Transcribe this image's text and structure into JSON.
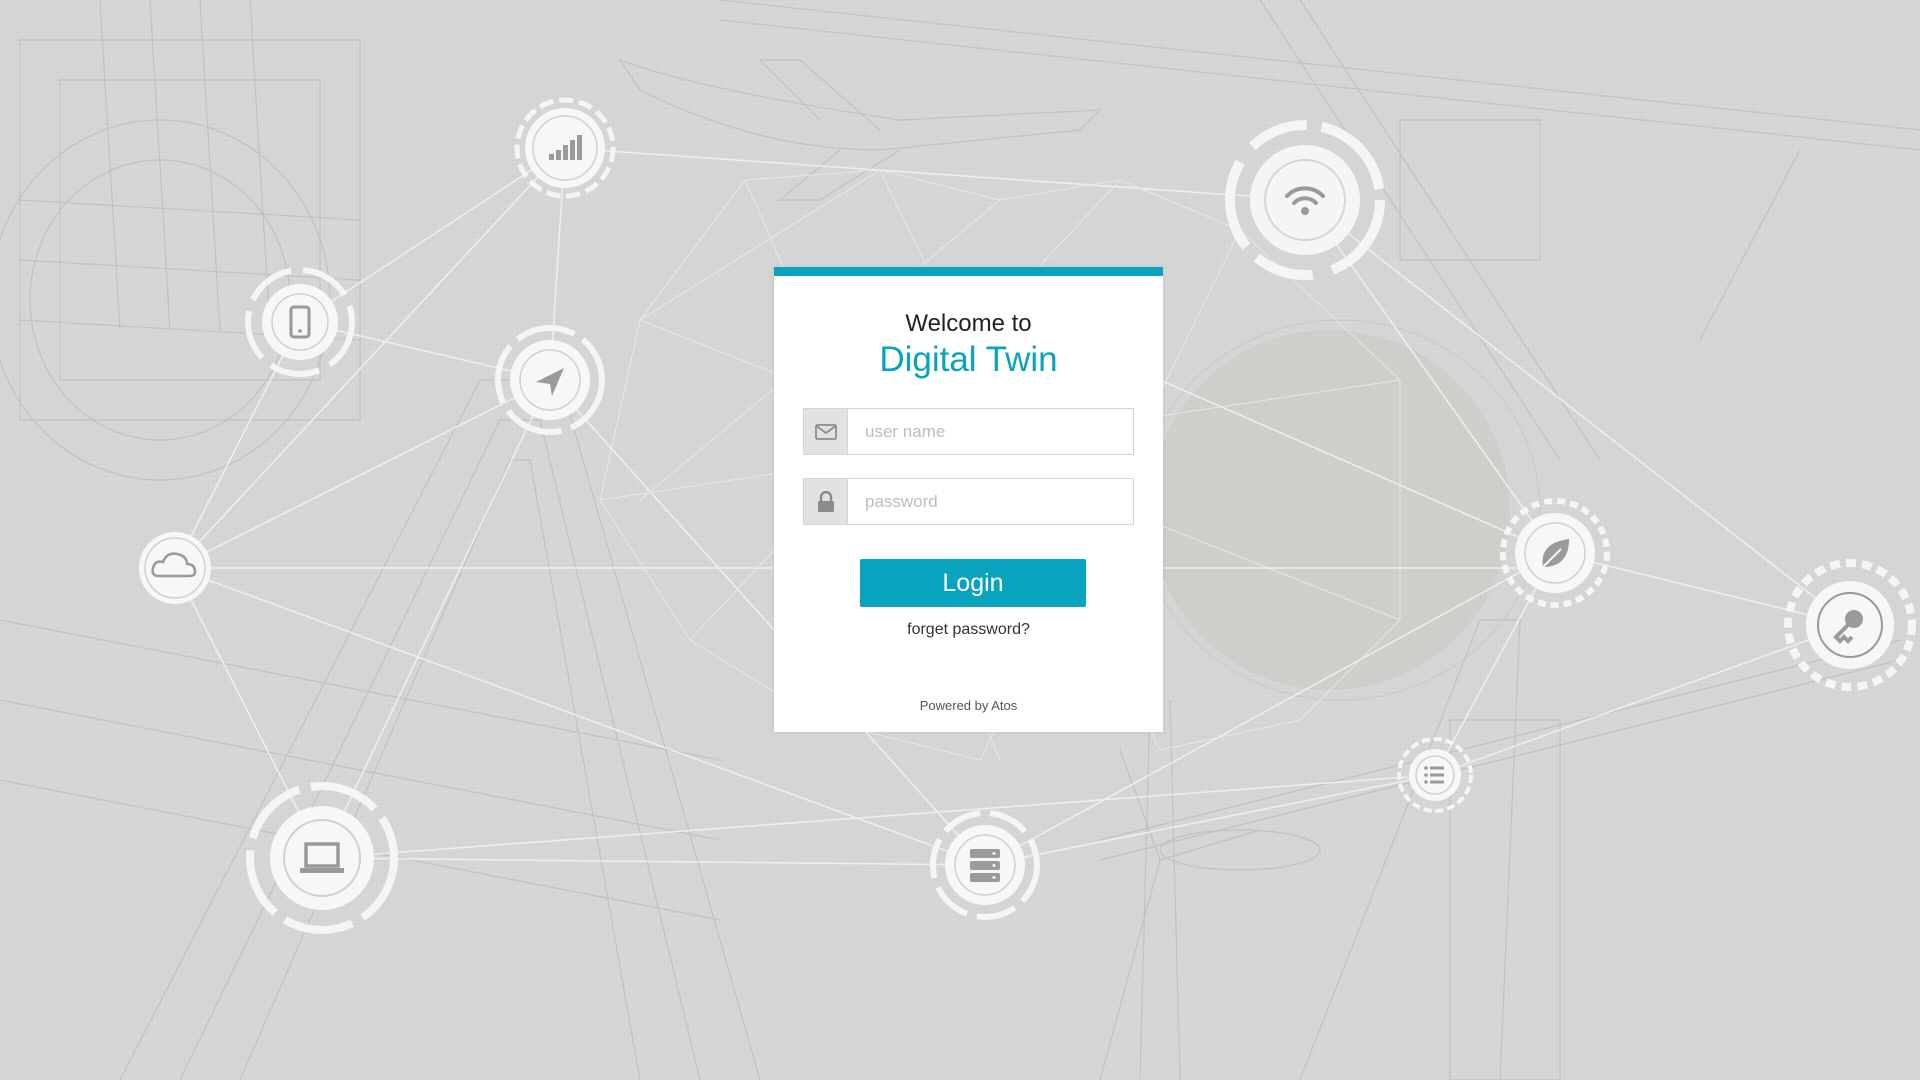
{
  "login": {
    "welcome_text": "Welcome to",
    "app_title": "Digital Twin",
    "username_placeholder": "user name",
    "password_placeholder": "password",
    "login_label": "Login",
    "forgot_label": "forget password?",
    "powered_by": "Powered by Atos"
  },
  "colors": {
    "accent": "#0aa3bd",
    "background": "#d6d6d6"
  },
  "background_icons": [
    "signal-bars-icon",
    "wifi-icon",
    "mobile-phone-icon",
    "navigation-arrow-icon",
    "cloud-icon",
    "leaf-icon",
    "key-icon",
    "list-icon",
    "laptop-icon",
    "database-server-icon"
  ]
}
